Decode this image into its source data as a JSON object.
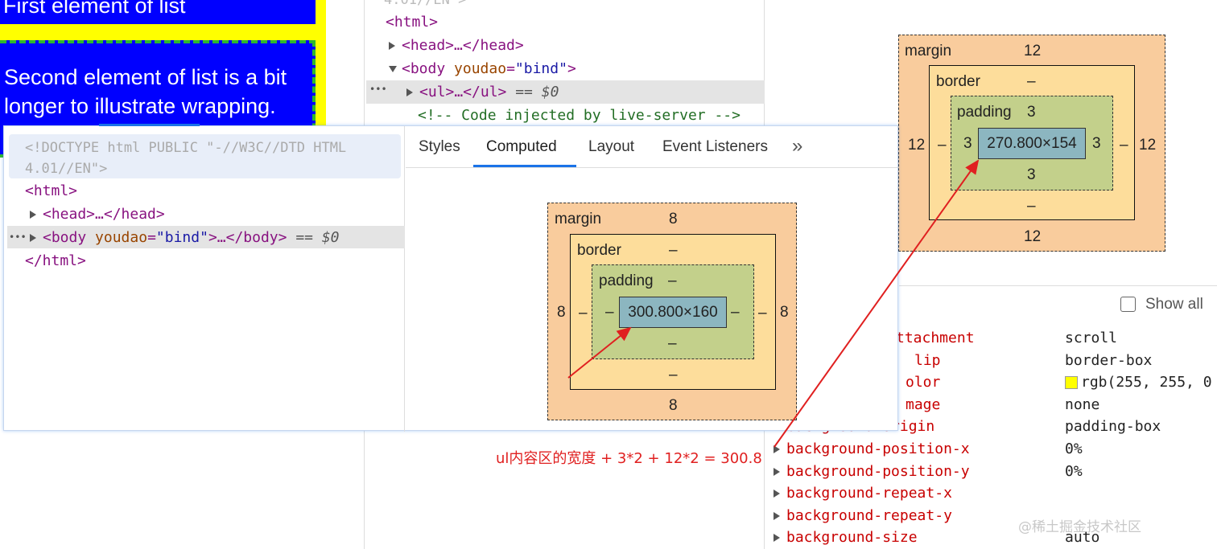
{
  "page": {
    "list_item_1": "First element of list",
    "list_item_2_line1": "Second element of list is a bit",
    "list_item_2_line2": "longer to illustrate wrapping."
  },
  "bg_elements": {
    "doctype_tail": "4.01//EN\">",
    "html_open": "<html>",
    "head_collapsed": "<head>…</head>",
    "body_open_tag": "<body",
    "body_attr_name": "youdao",
    "body_attr_value": "\"bind\"",
    "body_close_bracket": ">",
    "ul_collapsed": "<ul>…</ul>",
    "selected_marker": "== $0",
    "comment": "<!-- Code injected by live-server -->",
    "ellipsis": "•••"
  },
  "fg_elements": {
    "doctype_line1": "<!DOCTYPE html PUBLIC \"-//W3C//DTD HTML",
    "doctype_line2": "4.01//EN\">",
    "html_open": "<html>",
    "head_collapsed": "<head>…</head>",
    "body_open_tag": "<body",
    "body_attr_name": "youdao",
    "body_attr_value": "\"bind\"",
    "body_collapsed_rest": ">…</body>",
    "selected_marker": "== $0",
    "html_close": "</html>",
    "ellipsis": "•••"
  },
  "tabs": [
    {
      "label": "Styles",
      "active": false
    },
    {
      "label": "Computed",
      "active": true
    },
    {
      "label": "Layout",
      "active": false
    },
    {
      "label": "Event Listeners",
      "active": false
    }
  ],
  "tabs_more": "»",
  "box_model_body": {
    "margin_label": "margin",
    "margin_top": "8",
    "margin_right": "8",
    "margin_bottom": "8",
    "margin_left": "8",
    "border_label": "border",
    "border_top": "–",
    "border_right": "–",
    "border_bottom": "–",
    "border_left": "–",
    "padding_label": "padding",
    "padding_top": "–",
    "padding_right": "–",
    "padding_bottom": "–",
    "padding_left": "–",
    "content": "300.800×160"
  },
  "box_model_ul": {
    "margin_label": "margin",
    "margin_top": "12",
    "margin_right": "12",
    "margin_bottom": "12",
    "margin_left": "12",
    "border_label": "border",
    "border_top": "–",
    "border_right": "–",
    "border_bottom": "–",
    "border_left": "–",
    "padding_label": "padding",
    "padding_top": "3",
    "padding_right": "3",
    "padding_bottom": "3",
    "padding_left": "3",
    "content": "270.800×154"
  },
  "show_all_label": "Show all",
  "properties": [
    {
      "name": "ttachment",
      "value": "scroll",
      "expandable": false
    },
    {
      "name": "lip",
      "value": "border-box",
      "expandable": false
    },
    {
      "name": "olor",
      "value": "rgb(255, 255, 0",
      "expandable": false,
      "swatch": "#ffff00"
    },
    {
      "name": "mage",
      "value": "none",
      "expandable": false
    },
    {
      "name": "background-origin",
      "value": "padding-box",
      "expandable": false
    },
    {
      "name": "background-position-x",
      "value": "0%",
      "expandable": true
    },
    {
      "name": "background-position-y",
      "value": "0%",
      "expandable": true
    },
    {
      "name": "background-repeat-x",
      "value": "",
      "expandable": true
    },
    {
      "name": "background-repeat-y",
      "value": "",
      "expandable": true
    },
    {
      "name": "background-size",
      "value": "auto",
      "expandable": true
    }
  ],
  "annotation": "ul内容区的宽度 + 3*2 + 12*2 = 300.8",
  "watermark": "@稀土掘金技术社区",
  "colors": {
    "annotation": "#e02020",
    "list_bg": "#0000ff",
    "list_border": "#ffff00",
    "accent": "#1a73e8"
  }
}
